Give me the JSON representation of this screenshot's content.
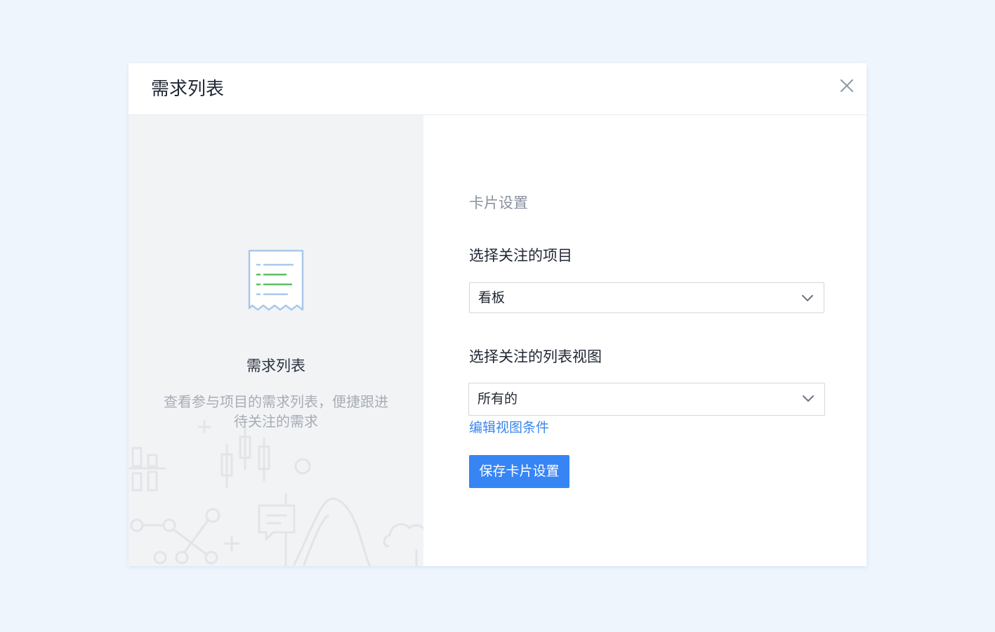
{
  "modal": {
    "title": "需求列表",
    "close_icon": "close-icon"
  },
  "left": {
    "icon": "list-document-icon",
    "title": "需求列表",
    "description": "查看参与项目的需求列表，便捷跟进待关注的需求"
  },
  "right": {
    "section_title": "卡片设置",
    "project_field": {
      "label": "选择关注的项目",
      "value": "看板"
    },
    "view_field": {
      "label": "选择关注的列表视图",
      "value": "所有的"
    },
    "edit_link": "编辑视图条件",
    "save_button": "保存卡片设置"
  },
  "colors": {
    "page_bg": "#eef5fd",
    "primary": "#3785f5",
    "link": "#3a86ee",
    "left_pane_bg": "#f2f3f5",
    "icon_green": "#5bbf5c",
    "icon_blue": "#a9c8ea"
  }
}
